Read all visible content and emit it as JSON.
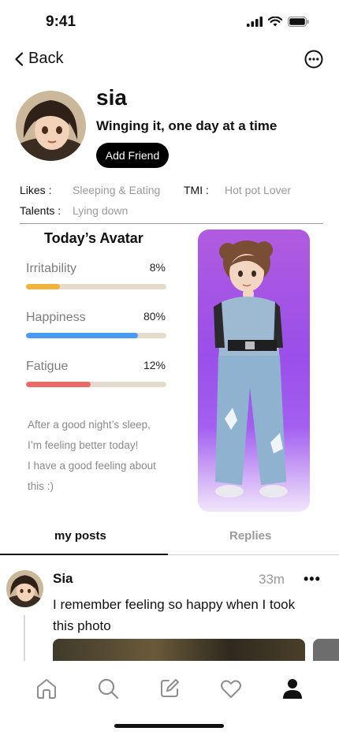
{
  "status_bar": {
    "time": "9:41"
  },
  "nav": {
    "back_label": "Back"
  },
  "profile": {
    "name": "sia",
    "bio": "Winging it, one day at a time",
    "add_friend_label": "Add Friend",
    "likes_label": "Likes :",
    "likes_value": "Sleeping & Eating",
    "tmi_label": "TMI :",
    "tmi_value": "Hot pot Lover",
    "talents_label": "Talents :",
    "talents_value": "Lying down"
  },
  "todays_avatar": {
    "title": "Today’s Avatar",
    "stats": [
      {
        "label": "Irritability",
        "percent_text": "8%",
        "value": 0.24,
        "color": "#f0b43c"
      },
      {
        "label": "Happiness",
        "percent_text": "80%",
        "value": 0.8,
        "color": "#4a9cf2"
      },
      {
        "label": "Fatigue",
        "percent_text": "12%",
        "value": 0.46,
        "color": "#ea6a6a"
      }
    ],
    "mood_lines": [
      "After a good night’s sleep,",
      "I’m feeling better today!",
      "I have a good feeling about",
      "this :)"
    ]
  },
  "tabs": {
    "posts": "my posts",
    "replies": "Replies",
    "active": "posts"
  },
  "post": {
    "author": "Sia",
    "time": "33m",
    "more": "•••",
    "text": "I remember feeling so happy when I took this photo"
  },
  "bottom_nav": [
    "home-icon",
    "search-icon",
    "compose-icon",
    "heart-icon",
    "profile-icon"
  ],
  "colors": {
    "accent": "#000000",
    "muted": "#9a9a9a",
    "avatar_bg": "#a35ff0"
  }
}
